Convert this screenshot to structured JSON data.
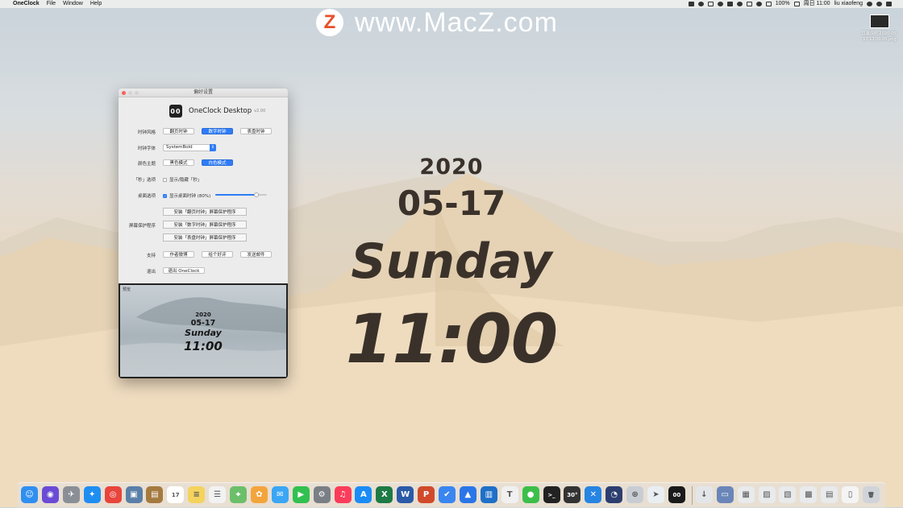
{
  "menubar": {
    "app_name": "OneClock",
    "menus": [
      "File",
      "Window",
      "Help"
    ],
    "battery": "100%",
    "datetime": "周日 11:00",
    "user": "liu xiaofeng"
  },
  "watermark": {
    "logo_letter": "Z",
    "text": "www.MacZ.com"
  },
  "desktop_file": {
    "name": "屏幕快照 2020-05-17 11.00.00.png"
  },
  "clock": {
    "year": "2020",
    "date": "05-17",
    "weekday": "Sunday",
    "time": "11:00"
  },
  "window": {
    "title": "偏好设置",
    "app_icon_text": "00",
    "app_name": "OneClock Desktop",
    "version": "v2.00",
    "rows": {
      "style": {
        "label": "时钟风格",
        "options": [
          "翻页时钟",
          "数字时钟",
          "表盘时钟"
        ],
        "selected": 1
      },
      "font": {
        "label": "时钟字体",
        "value": "SystemBold"
      },
      "theme": {
        "label": "颜色主题",
        "options": [
          "黑色模式",
          "白色模式"
        ],
        "selected": 1
      },
      "seconds": {
        "label": "「秒」选项",
        "checkbox": "显示/隐藏「秒」",
        "checked": false
      },
      "desktop": {
        "label": "桌面选项",
        "checkbox": "显示桌面时钟 (80%)",
        "checked": true,
        "slider_value": 0.8
      },
      "screensaver": {
        "label": "屏幕保护程序",
        "buttons": [
          "安装「翻页时钟」屏幕保护程序",
          "安装「数字时钟」屏幕保护程序",
          "安装「表盘时钟」屏幕保护程序"
        ]
      },
      "support": {
        "label": "支持",
        "buttons": [
          "作者微博",
          "给个好评",
          "发送邮件"
        ]
      },
      "quit": {
        "label": "退出",
        "button": "退出 OneClock"
      }
    },
    "preview": {
      "label": "预览",
      "year": "2020",
      "date": "05-17",
      "weekday": "Sunday",
      "time": "11:00"
    }
  },
  "dock": {
    "items": [
      {
        "name": "finder-icon",
        "color": "#2f8ff0",
        "glyph": "☺"
      },
      {
        "name": "siri-icon",
        "color": "#6a4bd6",
        "glyph": "◉"
      },
      {
        "name": "launchpad-icon",
        "color": "#8a8f96",
        "glyph": "✈"
      },
      {
        "name": "safari-icon",
        "color": "#1f8ef1",
        "glyph": "✦"
      },
      {
        "name": "chrome-icon",
        "color": "#e8453c",
        "glyph": "◎"
      },
      {
        "name": "preview-icon",
        "color": "#5a7fa8",
        "glyph": "▣"
      },
      {
        "name": "notes-brown-icon",
        "color": "#a57a3f",
        "glyph": "▤"
      },
      {
        "name": "calendar-icon",
        "color": "#ffffff",
        "glyph": "17"
      },
      {
        "name": "notes-icon",
        "color": "#f4d35e",
        "glyph": "≡"
      },
      {
        "name": "reminders-icon",
        "color": "#f2f2f2",
        "glyph": "☰"
      },
      {
        "name": "maps-icon",
        "color": "#6cbf6a",
        "glyph": "⌖"
      },
      {
        "name": "photos-icon",
        "color": "#f3a53c",
        "glyph": "✿"
      },
      {
        "name": "messages-icon",
        "color": "#3aa6f5",
        "glyph": "✉"
      },
      {
        "name": "facetime-icon",
        "color": "#32c050",
        "glyph": "▶"
      },
      {
        "name": "system-preferences-icon",
        "color": "#7a7f86",
        "glyph": "⚙"
      },
      {
        "name": "music-icon",
        "color": "#fb3c5a",
        "glyph": "♫"
      },
      {
        "name": "app-store-icon",
        "color": "#1a8cf6",
        "glyph": "A"
      },
      {
        "name": "excel-icon",
        "color": "#1e7a45",
        "glyph": "X"
      },
      {
        "name": "word-icon",
        "color": "#2b5aa8",
        "glyph": "W"
      },
      {
        "name": "powerpoint-icon",
        "color": "#d04a2b",
        "glyph": "P"
      },
      {
        "name": "tasks-icon",
        "color": "#3a86f0",
        "glyph": "✔"
      },
      {
        "name": "navigation-icon",
        "color": "#2a76e8",
        "glyph": "▲"
      },
      {
        "name": "trello-icon",
        "color": "#1e70c8",
        "glyph": "▥"
      },
      {
        "name": "typora-icon",
        "color": "#f0f0f0",
        "glyph": "T"
      },
      {
        "name": "wechat-icon",
        "color": "#3cbf4a",
        "glyph": "●"
      },
      {
        "name": "terminal-icon",
        "color": "#222222",
        "glyph": ">_"
      },
      {
        "name": "temperature-icon",
        "color": "#333333",
        "glyph": "30°"
      },
      {
        "name": "vscode-icon",
        "color": "#2684e2",
        "glyph": "✕"
      },
      {
        "name": "screensaver-icon",
        "color": "#2c3e70",
        "glyph": "◔"
      },
      {
        "name": "network-icon",
        "color": "#c8cdd4",
        "glyph": "⊛"
      },
      {
        "name": "telegram-icon",
        "color": "#e9eef3",
        "glyph": "➤"
      },
      {
        "name": "oneclock-icon",
        "color": "#1a1a1a",
        "glyph": "00"
      },
      {
        "name": "downloads-icon",
        "color": "#e3e6e9",
        "glyph": "↓"
      },
      {
        "name": "folder-stack-icon",
        "color": "#6a86b8",
        "glyph": "▭"
      },
      {
        "name": "docs-stack-icon",
        "color": "#e8eaec",
        "glyph": "▦"
      },
      {
        "name": "screenshots-stack-icon",
        "color": "#e8eaec",
        "glyph": "▨"
      },
      {
        "name": "images-stack-icon",
        "color": "#e8eaec",
        "glyph": "▧"
      },
      {
        "name": "desktop-stack-icon",
        "color": "#e8eaec",
        "glyph": "▩"
      },
      {
        "name": "files-stack-icon",
        "color": "#e8eaec",
        "glyph": "▤"
      },
      {
        "name": "pages-stack-icon",
        "color": "#f4f4f4",
        "glyph": "▯"
      },
      {
        "name": "trash-icon",
        "color": "#d0d4d8",
        "glyph": "🗑"
      }
    ]
  }
}
